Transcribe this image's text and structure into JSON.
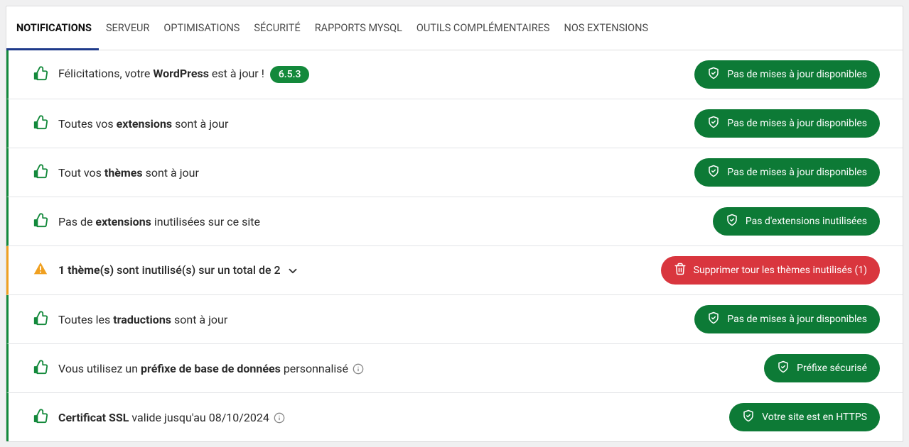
{
  "tabs": [
    {
      "label": "NOTIFICATIONS",
      "active": true
    },
    {
      "label": "SERVEUR",
      "active": false
    },
    {
      "label": "OPTIMISATIONS",
      "active": false
    },
    {
      "label": "SÉCURITÉ",
      "active": false
    },
    {
      "label": "RAPPORTS MYSQL",
      "active": false
    },
    {
      "label": "OUTILS COMPLÉMENTAIRES",
      "active": false
    },
    {
      "label": "NOS EXTENSIONS",
      "active": false
    }
  ],
  "rows": [
    {
      "status": "ok",
      "text_pre": "Félicitations, votre ",
      "text_bold": "WordPress",
      "text_post": " est à jour !",
      "badge": "6.5.3",
      "action": {
        "label": "Pas de mises à jour disponibles",
        "icon": "shield-check",
        "style": "green",
        "interact": false
      }
    },
    {
      "status": "ok",
      "text_pre": "Toutes vos ",
      "text_bold": "extensions",
      "text_post": " sont à jour",
      "action": {
        "label": "Pas de mises à jour disponibles",
        "icon": "shield-check",
        "style": "green",
        "interact": false
      }
    },
    {
      "status": "ok",
      "text_pre": "Tout vos ",
      "text_bold": "thèmes",
      "text_post": " sont à jour",
      "action": {
        "label": "Pas de mises à jour disponibles",
        "icon": "shield-check",
        "style": "green",
        "interact": false
      }
    },
    {
      "status": "ok",
      "text_pre": "Pas de ",
      "text_bold": "extensions",
      "text_post": " inutilisées sur ce site",
      "action": {
        "label": "Pas d'extensions inutilisées",
        "icon": "shield-check",
        "style": "green",
        "interact": false
      }
    },
    {
      "status": "warn",
      "text_pre": "",
      "text_bold": "1 thème(s)",
      "text_post": " sont inutilisé(s) sur un total de 2",
      "expandable": true,
      "action": {
        "label": "Supprimer tour les thèmes inutilisés (1)",
        "icon": "trash",
        "style": "red",
        "interact": true
      }
    },
    {
      "status": "ok",
      "text_pre": "Toutes les ",
      "text_bold": "traductions",
      "text_post": " sont à jour",
      "action": {
        "label": "Pas de mises à jour disponibles",
        "icon": "shield-check",
        "style": "green",
        "interact": false
      }
    },
    {
      "status": "ok",
      "text_pre": "Vous utilisez un ",
      "text_bold": "préfixe de base de données",
      "text_post": " personnalisé",
      "info": true,
      "action": {
        "label": "Préfixe sécurisé",
        "icon": "shield-check",
        "style": "green",
        "interact": false
      }
    },
    {
      "status": "ok",
      "text_pre": "",
      "text_bold": "Certificat SSL",
      "text_post": " valide jusqu'au 08/10/2024",
      "info": true,
      "action": {
        "label": "Votre site est en HTTPS",
        "icon": "shield-check",
        "style": "green",
        "interact": false
      }
    }
  ]
}
